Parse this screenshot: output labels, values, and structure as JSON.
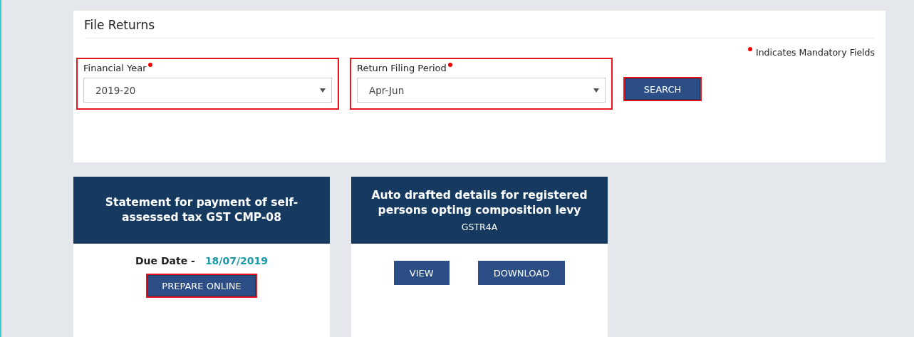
{
  "panel": {
    "title": "File Returns",
    "mandatory_note": "Indicates Mandatory Fields",
    "fields": [
      {
        "label": "Financial Year",
        "value": "2019-20",
        "required": true,
        "highlighted": true
      },
      {
        "label": "Return Filing Period",
        "value": "Apr-Jun",
        "required": true,
        "highlighted": true
      }
    ],
    "search_button": {
      "label": "SEARCH",
      "highlighted": true
    }
  },
  "cards": [
    {
      "title": "Statement for payment of self-assessed tax GST CMP-08",
      "due_label": "Due Date -",
      "due_date": "18/07/2019",
      "buttons": [
        {
          "label": "PREPARE ONLINE",
          "highlighted": true
        }
      ]
    },
    {
      "title": "Auto drafted details for registered persons opting composition levy",
      "subtitle": "GSTR4A",
      "buttons": [
        {
          "label": "VIEW",
          "highlighted": false
        },
        {
          "label": "DOWNLOAD",
          "highlighted": false
        }
      ]
    }
  ]
}
